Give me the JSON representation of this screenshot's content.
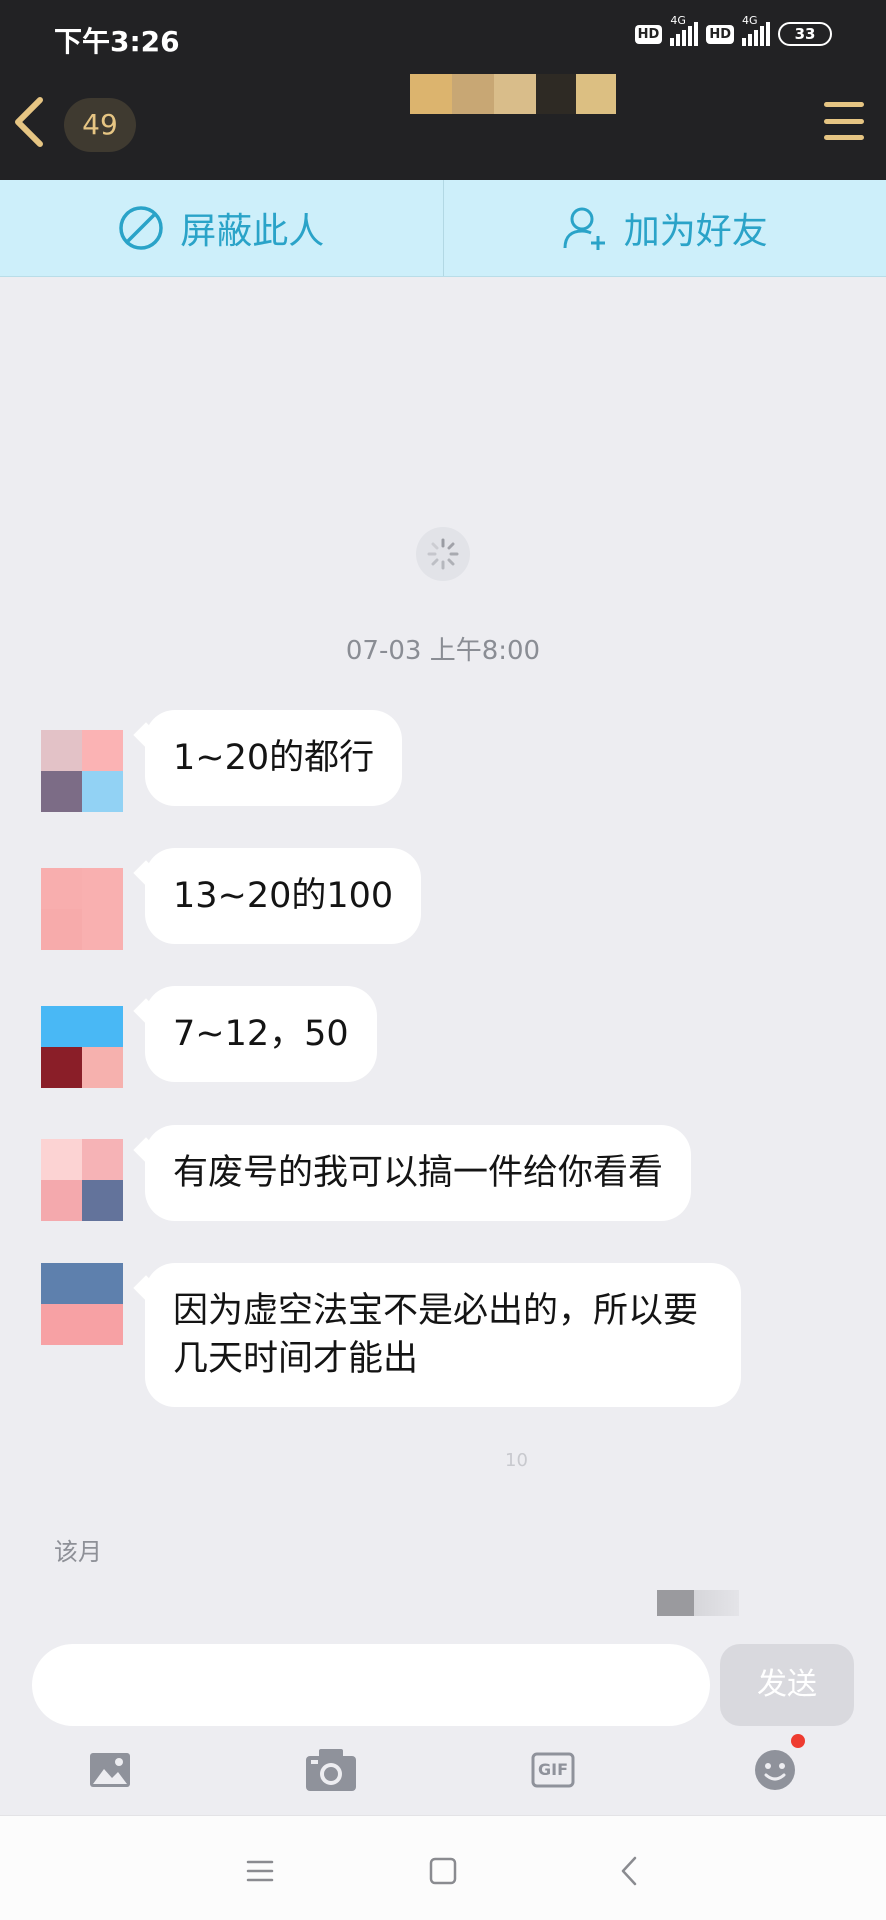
{
  "status_bar": {
    "time": "下午3:26",
    "hd1": "HD",
    "net1": "4G",
    "hd2": "HD",
    "net2": "4G",
    "battery": "33"
  },
  "header": {
    "unread_count": "49",
    "back_icon": "chevron-left-icon",
    "menu_icon": "hamburger-menu-icon",
    "accent_color": "#e6c583"
  },
  "actions": {
    "block_label": "屏蔽此人",
    "add_friend_label": "加为好友",
    "color": "#2aa3c8"
  },
  "chat": {
    "timestamp": "07-03 上午8:00",
    "messages": [
      {
        "text": "1~20的都行"
      },
      {
        "text": "13~20的100"
      },
      {
        "text": "7~12，50"
      },
      {
        "text": "有废号的我可以搞一件给你看看"
      },
      {
        "text": "因为虚空法宝不是必出的，所以要几天时间才能出"
      }
    ],
    "faded_number": "10",
    "faded_note": "该月"
  },
  "composer": {
    "input_value": "",
    "send_label": "发送",
    "tools": [
      "image-icon",
      "camera-icon",
      "gif-icon",
      "emoji-icon"
    ],
    "gif_label": "GIF"
  }
}
